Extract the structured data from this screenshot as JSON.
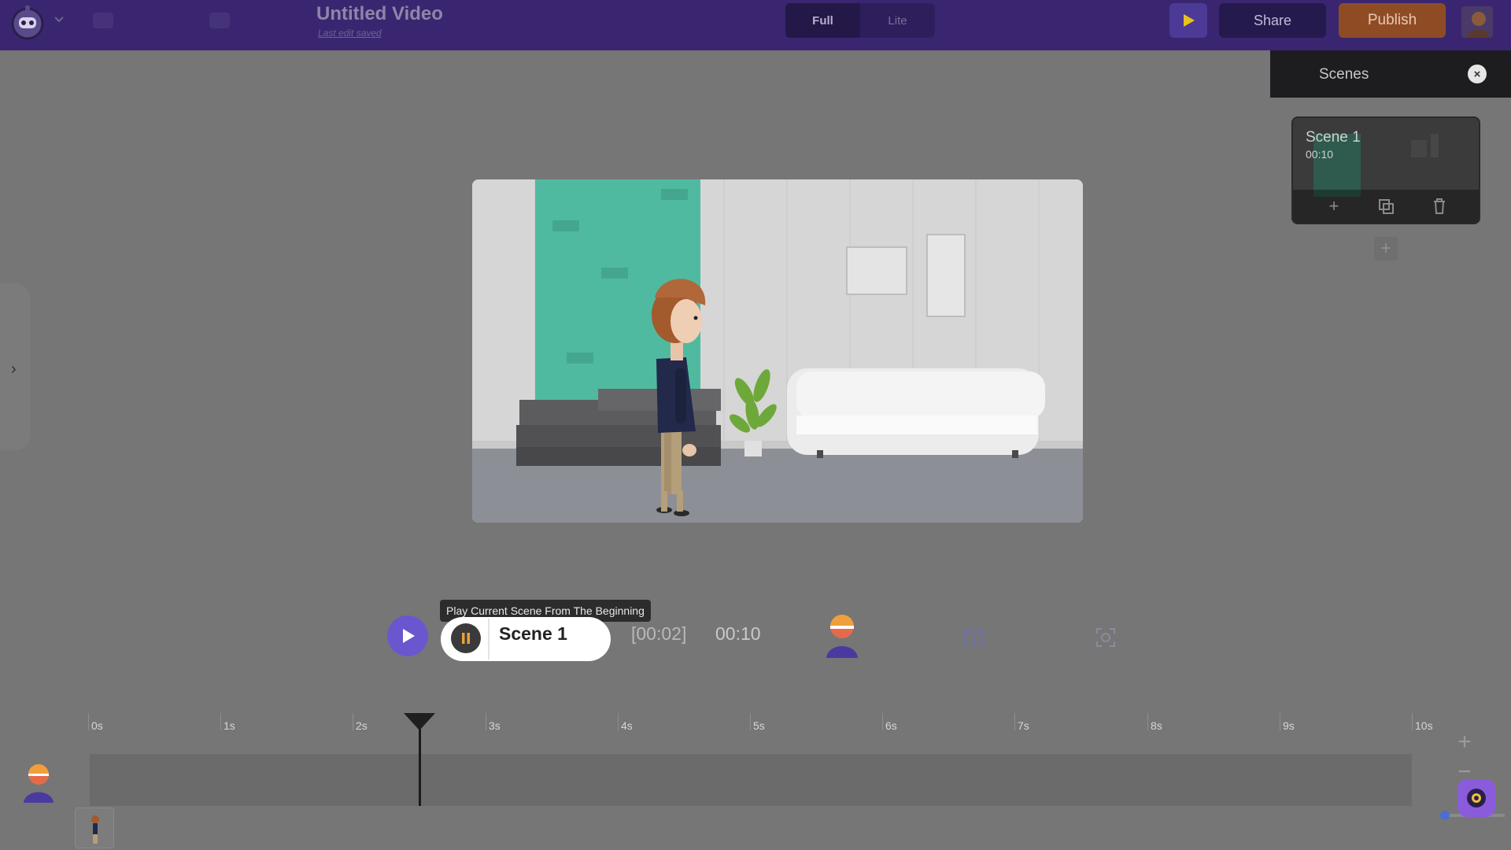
{
  "app": {
    "title": "Untitled Video",
    "last_edit": "Last edit saved"
  },
  "mode_toggle": {
    "options": [
      "Full",
      "Lite"
    ],
    "selected": "Full"
  },
  "toolbar": {
    "share_label": "Share",
    "publish_label": "Publish"
  },
  "scenes_panel": {
    "title": "Scenes",
    "close_glyph": "×",
    "scenes": [
      {
        "name": "Scene 1",
        "duration": "00:10"
      }
    ],
    "add_glyph": "+"
  },
  "left_panel": {
    "chevron_glyph": "›"
  },
  "playback": {
    "tooltip": "Play Current Scene From The Beginning",
    "scene_label": "Scene 1",
    "current_time": "[00:02]",
    "total_time": "00:10"
  },
  "timeline": {
    "ticks": [
      "0s",
      "1s",
      "2s",
      "3s",
      "4s",
      "5s",
      "6s",
      "7s",
      "8s",
      "9s",
      "10s"
    ],
    "playhead_seconds": 2.5,
    "zoom_in_glyph": "+",
    "zoom_out_glyph": "−"
  },
  "colors": {
    "topbar": "#3a2670",
    "accent": "#6a57cf",
    "publish": "#8f4c24",
    "wall_green": "#4fbaa0"
  },
  "icons": {
    "logo": "robot-logo-icon",
    "play": "play-icon",
    "pause": "pause-icon",
    "character": "character-icon",
    "clip": "film-clip-icon",
    "camera": "camera-icon",
    "duplicate": "duplicate-icon",
    "delete": "trash-icon"
  }
}
